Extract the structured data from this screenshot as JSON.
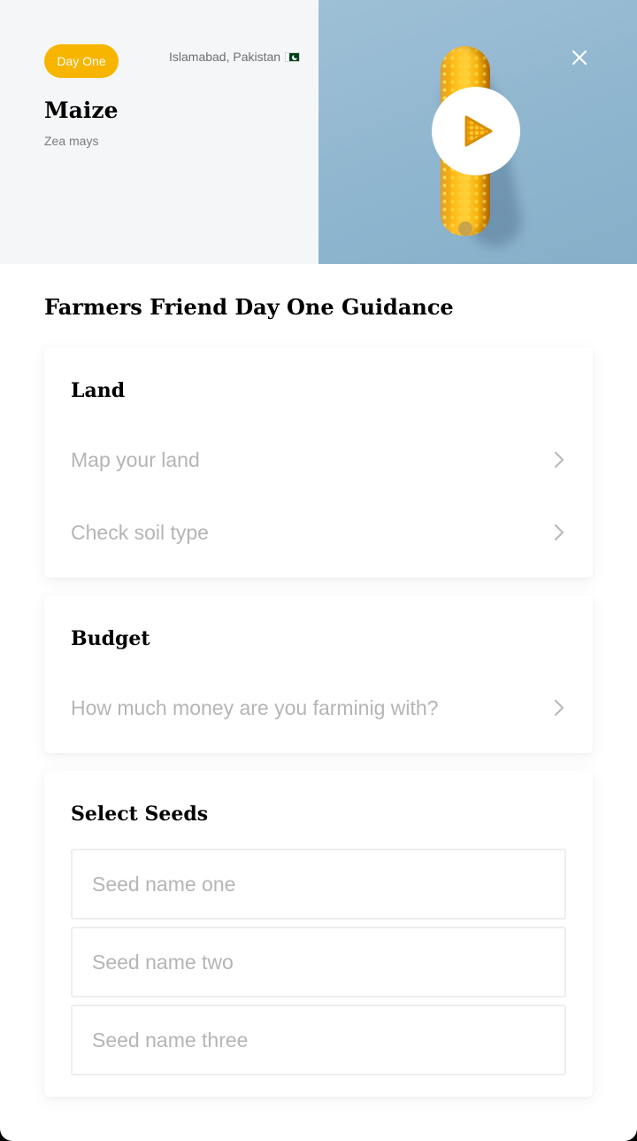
{
  "header": {
    "badge_label": "Day One",
    "location": "Islamabad, Pakistan",
    "crop_name": "Maize",
    "crop_scientific_name": "Zea mays",
    "flag_icon": "pakistan-flag-icon",
    "play_icon": "play-icon",
    "close_icon": "close-icon"
  },
  "guidance": {
    "heading": "Farmers Friend Day One Guidance",
    "land": {
      "title": "Land",
      "items": [
        {
          "label": "Map your land",
          "icon": "chevron-right-icon"
        },
        {
          "label": "Check soil type",
          "icon": "chevron-right-icon"
        }
      ]
    },
    "budget": {
      "title": "Budget",
      "items": [
        {
          "label": "How much money are you farminig with?",
          "icon": "chevron-right-icon"
        }
      ]
    },
    "seeds": {
      "title": "Select Seeds",
      "inputs": [
        {
          "placeholder": "Seed name one",
          "value": ""
        },
        {
          "placeholder": "Seed name two",
          "value": ""
        },
        {
          "placeholder": "Seed name three",
          "value": ""
        }
      ]
    }
  },
  "colors": {
    "accent": "#f7b500",
    "header_left_bg": "#f5f6f8",
    "header_image_bg": "#8fb6cf",
    "muted_text": "#b5b5b5",
    "chevron": "#b9b9b9"
  }
}
